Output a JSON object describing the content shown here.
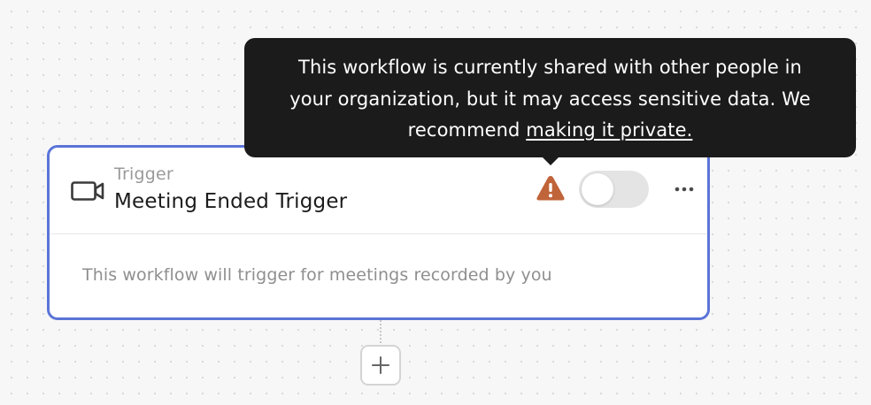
{
  "tooltip": {
    "line1": "This workflow is currently shared with other people in",
    "line2": "your organization, but it may access sensitive data. We",
    "line3_prefix": "recommend ",
    "link_text": "making it private."
  },
  "trigger_card": {
    "kicker": "Trigger",
    "title": "Meeting Ended Trigger",
    "description": "This workflow will trigger for meetings recorded by you",
    "toggle_enabled": false
  },
  "icons": {
    "trigger": "video-camera-icon",
    "warning": "warning-triangle-icon",
    "more": "more-horizontal-icon",
    "add": "plus-icon"
  },
  "colors": {
    "card_border": "#5b74d8",
    "warning": "#c0643a",
    "tooltip_bg": "#1b1b1b"
  }
}
